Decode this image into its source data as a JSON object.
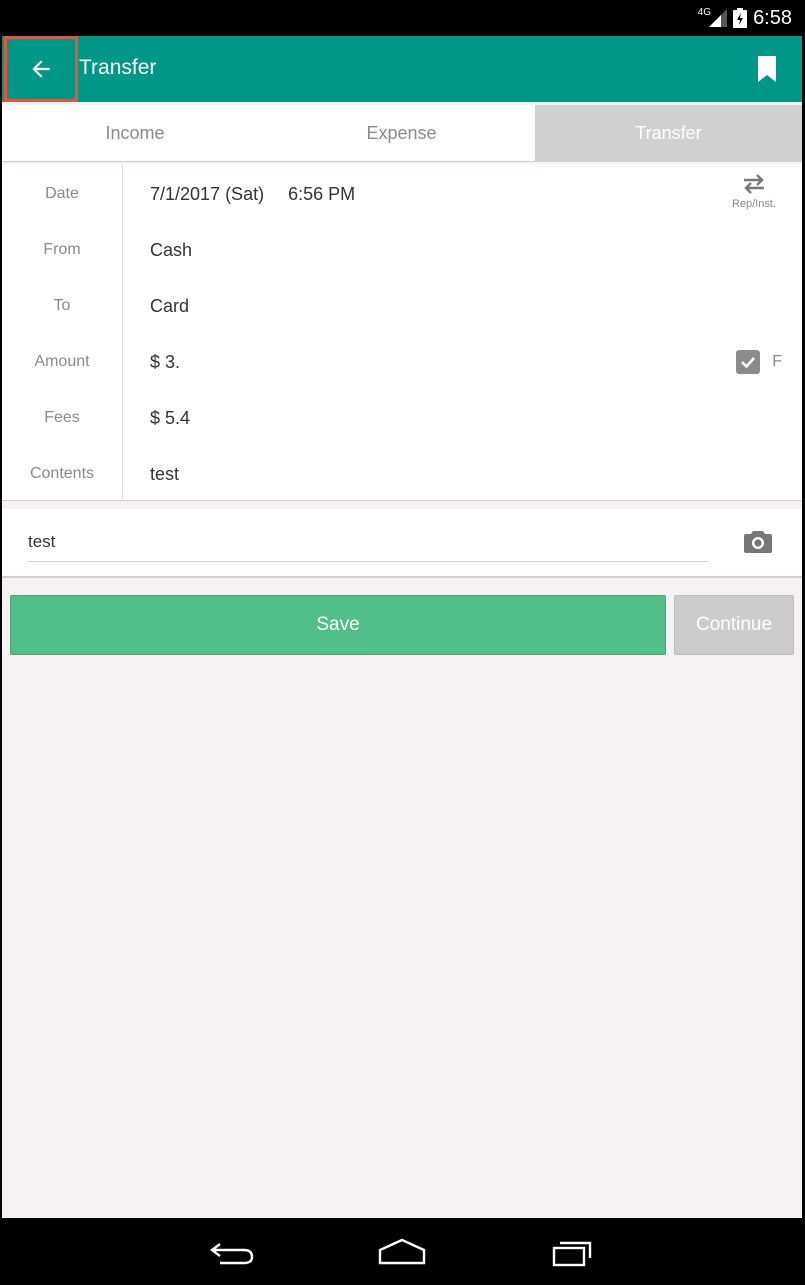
{
  "status_bar": {
    "network": "4G",
    "time": "6:58"
  },
  "app_bar": {
    "title": "Transfer"
  },
  "tabs": [
    {
      "label": "Income",
      "active": false
    },
    {
      "label": "Expense",
      "active": false
    },
    {
      "label": "Transfer",
      "active": true
    }
  ],
  "form": {
    "date": {
      "label": "Date",
      "date_value": "7/1/2017 (Sat)",
      "time_value": "6:56 PM",
      "repeat_label": "Rep/Inst."
    },
    "from": {
      "label": "From",
      "value": "Cash"
    },
    "to": {
      "label": "To",
      "value": "Card"
    },
    "amount": {
      "label": "Amount",
      "value": "$ 3.",
      "toggle_label": "F",
      "toggle_checked": true
    },
    "fees": {
      "label": "Fees",
      "value": "$ 5.4"
    },
    "contents": {
      "label": "Contents",
      "value": "test"
    }
  },
  "memo": {
    "value": "test"
  },
  "actions": {
    "save_label": "Save",
    "continue_label": "Continue"
  },
  "colors": {
    "primary": "#009688",
    "save": "#52be88",
    "continue": "#cccccc",
    "highlight": "#e8563a"
  }
}
